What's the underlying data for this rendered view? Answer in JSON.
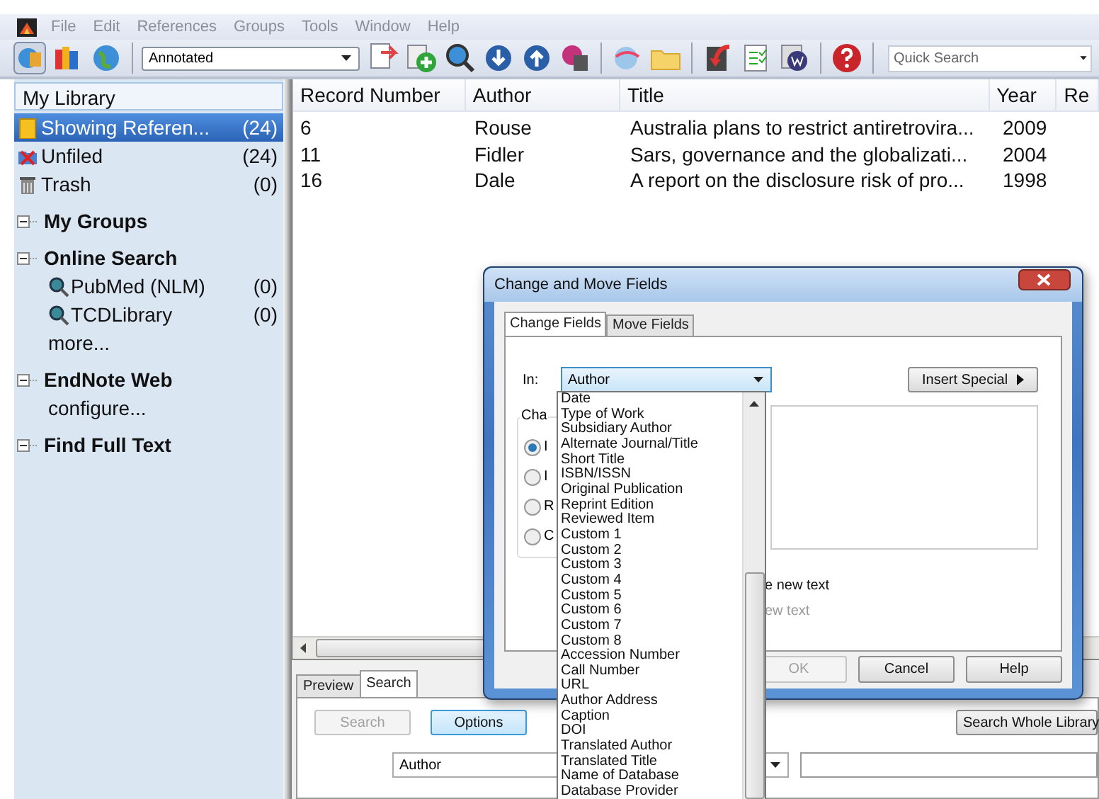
{
  "menu": [
    "File",
    "Edit",
    "References",
    "Groups",
    "Tools",
    "Window",
    "Help"
  ],
  "toolbar": {
    "style_value": "Annotated",
    "quick_search": {
      "placeholder": "Quick Search"
    }
  },
  "sidebar": {
    "header": "My Library",
    "items": [
      {
        "kind": "all",
        "label": "Showing Referen...",
        "count": "(24)",
        "selected": true
      },
      {
        "kind": "unfiled",
        "label": "Unfiled",
        "count": "(24)",
        "selected": false
      },
      {
        "kind": "trash",
        "label": "Trash",
        "count": "(0)",
        "selected": false
      }
    ],
    "groups": [
      {
        "title": "My Groups",
        "expanded": true
      },
      {
        "title": "Online Search",
        "expanded": true,
        "items": [
          {
            "kind": "search",
            "label": "PubMed (NLM)",
            "count": "(0)"
          },
          {
            "kind": "search",
            "label": "TCDLibrary",
            "count": "(0)"
          },
          {
            "kind": "link",
            "label": "more..."
          }
        ]
      },
      {
        "title": "EndNote Web",
        "expanded": true,
        "items": [
          {
            "kind": "link",
            "label": "configure..."
          }
        ]
      },
      {
        "title": "Find Full Text",
        "expanded": true
      }
    ]
  },
  "table": {
    "columns": [
      "Record Number",
      "Author",
      "Title",
      "Year",
      "Re"
    ],
    "rows": [
      [
        "6",
        "Rouse",
        "Australia plans to restrict antiretrovira...",
        "2009"
      ],
      [
        "11",
        "Fidler",
        "Sars, governance and the globalizati...",
        "2004"
      ],
      [
        "16",
        "Dale",
        "A report on the disclosure risk of pro...",
        "1998"
      ]
    ]
  },
  "bottom_pane": {
    "tabs": [
      {
        "label": "Preview",
        "selected": false
      },
      {
        "label": "Search",
        "selected": true
      }
    ],
    "buttons": [
      {
        "label": "Search",
        "disabled": true
      },
      {
        "label": "Options",
        "disabled": false
      }
    ],
    "search_whole_library": "Search Whole Library",
    "field": "Author"
  },
  "dialog": {
    "title": "Change and Move Fields",
    "tabs": [
      {
        "label": "Change Fields",
        "selected": true
      },
      {
        "label": "Move Fields",
        "selected": false
      }
    ],
    "in_label": "In:",
    "in_value": "Author",
    "insert_special": "Insert Special",
    "group_label": "Cha",
    "radios": [
      {
        "label": "I",
        "selected": true
      },
      {
        "label": "I",
        "selected": false
      },
      {
        "label": "R",
        "selected": false
      },
      {
        "label": "C",
        "selected": false
      }
    ],
    "options": [
      {
        "label": "e new text",
        "disabled": false
      },
      {
        "label": "ew text",
        "disabled": true
      }
    ],
    "buttons": [
      {
        "label": "OK",
        "disabled": true
      },
      {
        "label": "Cancel",
        "disabled": false
      },
      {
        "label": "Help",
        "disabled": false
      }
    ],
    "dropdown": [
      "Date",
      "Type of Work",
      "Subsidiary Author",
      "Alternate Journal/Title",
      "Short Title",
      "ISBN/ISSN",
      "Original Publication",
      "Reprint Edition",
      "Reviewed Item",
      "Custom 1",
      "Custom 2",
      "Custom 3",
      "Custom 4",
      "Custom 5",
      "Custom 6",
      "Custom 7",
      "Custom 8",
      "Accession Number",
      "Call Number",
      "URL",
      "Author Address",
      "Caption",
      "DOI",
      "Translated Author",
      "Translated Title",
      "Name of Database",
      "Database Provider"
    ]
  }
}
